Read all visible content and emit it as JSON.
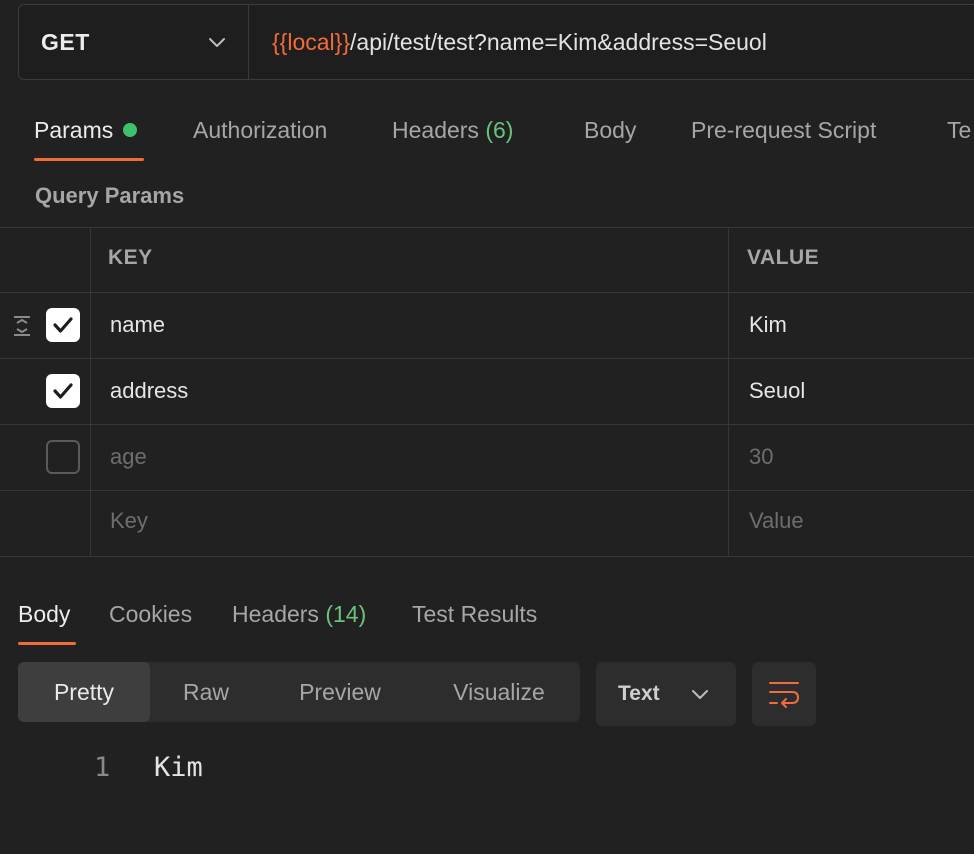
{
  "request": {
    "method": "GET",
    "url_variable": "{{local}}",
    "url_path": "/api/test/test?name=Kim&address=Seuol"
  },
  "request_tabs": [
    {
      "label": "Params",
      "count": ""
    },
    {
      "label": "Authorization",
      "count": ""
    },
    {
      "label": "Headers",
      "count": "(6)"
    },
    {
      "label": "Body",
      "count": ""
    },
    {
      "label": "Pre-request Script",
      "count": ""
    },
    {
      "label": "Te",
      "count": ""
    }
  ],
  "params": {
    "section_title": "Query Params",
    "columns": {
      "key": "KEY",
      "value": "VALUE"
    },
    "rows": [
      {
        "key": "name",
        "value": "Kim",
        "checked": true
      },
      {
        "key": "address",
        "value": "Seuol",
        "checked": true
      },
      {
        "key": "age",
        "value": "30",
        "checked": false
      }
    ],
    "new_row": {
      "key_placeholder": "Key",
      "value_placeholder": "Value"
    }
  },
  "response_tabs": [
    {
      "label": "Body",
      "count": ""
    },
    {
      "label": "Cookies",
      "count": ""
    },
    {
      "label": "Headers",
      "count": "(14)"
    },
    {
      "label": "Test Results",
      "count": ""
    }
  ],
  "view_modes": [
    "Pretty",
    "Raw",
    "Preview",
    "Visualize"
  ],
  "active_view_mode": "Pretty",
  "format": "Text",
  "response_body": {
    "line_number": "1",
    "content": "Kim"
  },
  "icons": {
    "method_dropdown": "chevron-down-icon",
    "drag": "drag-handle-icon",
    "check": "checkmark-icon",
    "format_dropdown": "chevron-down-icon",
    "wrap": "wrap-lines-icon"
  },
  "colors": {
    "accent": "#f26b3a",
    "status_dot": "#3ec16a",
    "count": "#6bc27a",
    "background": "#212121"
  }
}
